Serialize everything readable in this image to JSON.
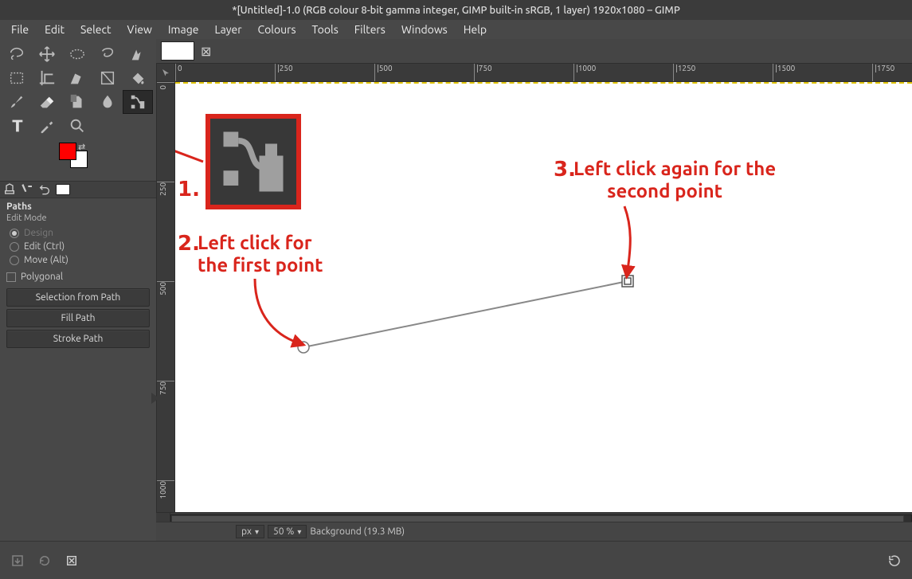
{
  "title": "*[Untitled]-1.0 (RGB colour 8-bit gamma integer, GIMP built-in sRGB, 1 layer) 1920x1080 – GIMP",
  "menu": [
    "File",
    "Edit",
    "Select",
    "View",
    "Image",
    "Layer",
    "Colours",
    "Tools",
    "Filters",
    "Windows",
    "Help"
  ],
  "tooloptions": {
    "title": "Paths",
    "editmode_label": "Edit Mode",
    "modes": {
      "design": "Design",
      "edit": "Edit (Ctrl)",
      "move": "Move (Alt)"
    },
    "polygonal": "Polygonal",
    "btn_sel": "Selection from Path",
    "btn_fill": "Fill Path",
    "btn_stroke": "Stroke Path"
  },
  "ruler": {
    "h": [
      "0",
      "|250",
      "|500",
      "|750",
      "|1000",
      "|1250",
      "|1500",
      "|1750"
    ],
    "v": [
      "0",
      "250",
      "500",
      "750",
      "1000"
    ]
  },
  "status": {
    "unit": "px",
    "zoom": "50 %",
    "layer": "Background (19.3 MB)"
  },
  "annotations": {
    "step1": "1.",
    "step2": "2.",
    "step2_line1": "Left click for",
    "step2_line2": "the first point",
    "step3": "3.",
    "step3_line1": "Left click again for the",
    "step3_line2": "second point"
  }
}
